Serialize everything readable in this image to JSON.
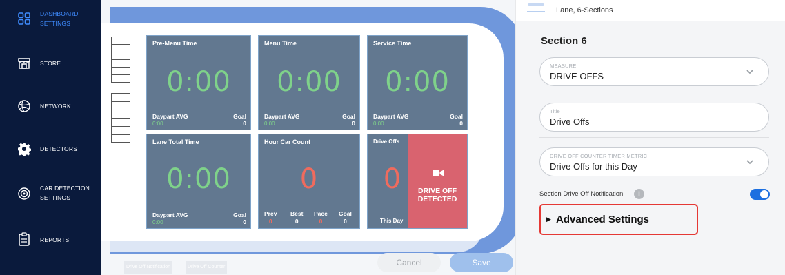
{
  "sidebar": {
    "items": [
      {
        "label": "DASHBOARD\nSETTINGS",
        "icon": "dashboard-grid-icon",
        "active": true
      },
      {
        "label": "STORE",
        "icon": "store-icon"
      },
      {
        "label": "NETWORK",
        "icon": "network-globe-icon"
      },
      {
        "label": "DETECTORS",
        "icon": "gear-icon"
      },
      {
        "label": "CAR DETECTION\nSETTINGS",
        "icon": "detection-target-icon"
      },
      {
        "label": "REPORTS",
        "icon": "clipboard-icon"
      }
    ]
  },
  "preview": {
    "tiles": [
      {
        "title": "Pre-Menu Time",
        "value": "0:00",
        "foot_left": "Daypart AVG",
        "foot_left_value": "0:00",
        "foot_right": "Goal",
        "foot_right_value": "0"
      },
      {
        "title": "Menu Time",
        "value": "0:00",
        "foot_left": "Daypart AVG",
        "foot_left_value": "0:00",
        "foot_right": "Goal",
        "foot_right_value": "0"
      },
      {
        "title": "Service Time",
        "value": "0:00",
        "foot_left": "Daypart AVG",
        "foot_left_value": "0:00",
        "foot_right": "Goal",
        "foot_right_value": "0"
      },
      {
        "title": "Lane Total Time",
        "value": "0:00",
        "foot_left": "Daypart AVG",
        "foot_left_value": "0:00",
        "foot_right": "Goal",
        "foot_right_value": "0"
      }
    ],
    "hour_car_count": {
      "title": "Hour Car Count",
      "value": "0",
      "stats": [
        {
          "label": "Prev",
          "value": "0"
        },
        {
          "label": "Best",
          "value": "0"
        },
        {
          "label": "Pace",
          "value": "0"
        },
        {
          "label": "Goal",
          "value": "0"
        }
      ]
    },
    "drive_offs": {
      "title": "Drive Offs",
      "value": "0",
      "caption": "This Day",
      "alert_icon": "video-camera-icon",
      "alert_text": "DRIVE OFF\nDETECTED"
    },
    "chips": [
      "Drive Off Notification",
      "Drive Off Counter"
    ],
    "cancel_label": "Cancel",
    "save_label": "Save"
  },
  "panel": {
    "top_label": "Lane, 6-Sections",
    "section_title": "Section 6",
    "measure": {
      "label": "MEASURE",
      "value": "DRIVE OFFS"
    },
    "title_field": {
      "label": "Title",
      "value": "Drive Offs"
    },
    "metric": {
      "label": "DRIVE OFF COUNTER TIMER METRIC",
      "value": "Drive Offs for this Day"
    },
    "notification_label": "Section Drive Off Notification",
    "notification_enabled": true,
    "advanced_label": "Advanced Settings"
  },
  "colors": {
    "sidebar_bg": "#0a1a3c",
    "active_nav": "#3f8cff",
    "tile_bg": "#627890",
    "timer_green": "#7fd28a",
    "count_red": "#ef6b5e",
    "alert_bg": "#d9636f",
    "toggle_on": "#1c6fe0",
    "highlight_border": "#e53935"
  }
}
